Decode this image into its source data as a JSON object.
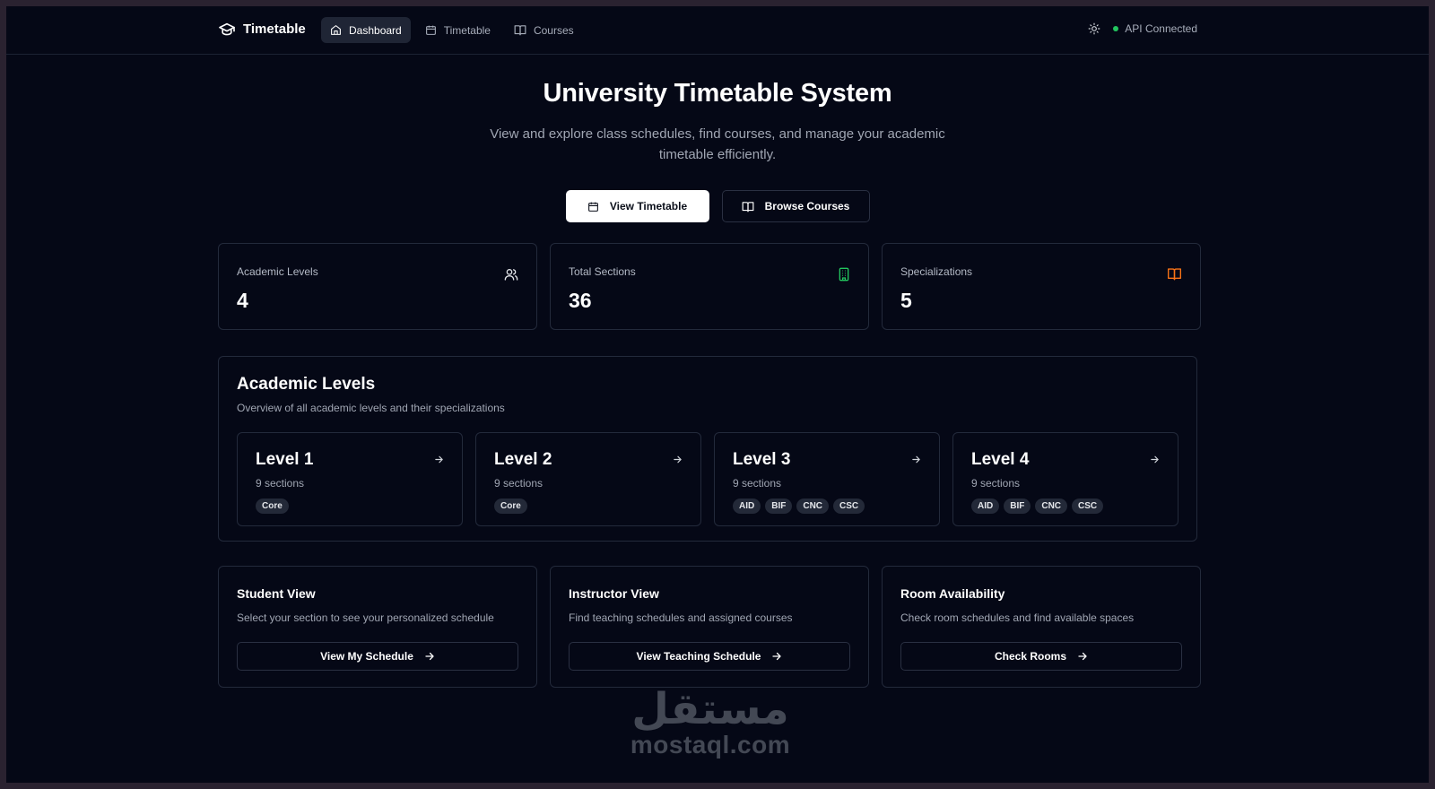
{
  "nav": {
    "brand": "Timetable",
    "links": [
      {
        "label": "Dashboard",
        "icon": "home-icon",
        "active": true
      },
      {
        "label": "Timetable",
        "icon": "calendar-icon",
        "active": false
      },
      {
        "label": "Courses",
        "icon": "book-icon",
        "active": false
      }
    ],
    "status_text": "API Connected",
    "status_color": "#22c55e"
  },
  "hero": {
    "title": "University Timetable System",
    "subtitle": "View and explore class schedules, find courses, and manage your academic timetable efficiently.",
    "primary_label": "View Timetable",
    "secondary_label": "Browse Courses"
  },
  "stats": [
    {
      "label": "Academic Levels",
      "value": "4",
      "icon": "users-icon",
      "color": "#e5e7eb"
    },
    {
      "label": "Total Sections",
      "value": "36",
      "icon": "building-icon",
      "color": "#22c55e"
    },
    {
      "label": "Specializations",
      "value": "5",
      "icon": "book-open-icon",
      "color": "#f97316"
    }
  ],
  "levels": {
    "title": "Academic Levels",
    "subtitle": "Overview of all academic levels and their specializations",
    "items": [
      {
        "title": "Level 1",
        "sections": "9 sections",
        "badges": [
          "Core"
        ]
      },
      {
        "title": "Level 2",
        "sections": "9 sections",
        "badges": [
          "Core"
        ]
      },
      {
        "title": "Level 3",
        "sections": "9 sections",
        "badges": [
          "AID",
          "BIF",
          "CNC",
          "CSC"
        ]
      },
      {
        "title": "Level 4",
        "sections": "9 sections",
        "badges": [
          "AID",
          "BIF",
          "CNC",
          "CSC"
        ]
      }
    ]
  },
  "views": [
    {
      "title": "Student View",
      "description": "Select your section to see your personalized schedule",
      "button": "View My Schedule"
    },
    {
      "title": "Instructor View",
      "description": "Find teaching schedules and assigned courses",
      "button": "View Teaching Schedule"
    },
    {
      "title": "Room Availability",
      "description": "Check room schedules and find available spaces",
      "button": "Check Rooms"
    }
  ],
  "watermark": {
    "arabic": "مستقل",
    "latin": "mostaql.com"
  }
}
